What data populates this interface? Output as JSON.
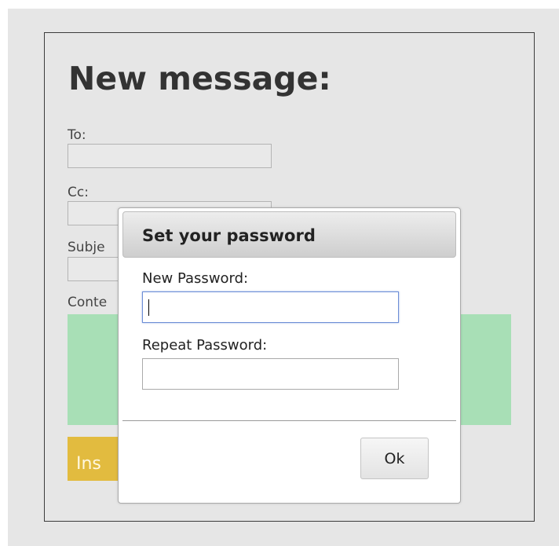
{
  "form": {
    "title": "New message:",
    "to_label": "To:",
    "cc_label": "Cc:",
    "subject_label": "Subje",
    "content_label": "Conte",
    "insert_label": "Ins"
  },
  "dialog": {
    "title": "Set your password",
    "new_password_label": "New Password:",
    "repeat_password_label": "Repeat Password:",
    "new_password_value": "",
    "repeat_password_value": "",
    "ok_label": "Ok"
  },
  "colors": {
    "page_background": "#e6e6e6",
    "content_area": "#a8dfb6",
    "insert_button": "#e2bb3f",
    "focus_border": "#6d8ed6"
  }
}
